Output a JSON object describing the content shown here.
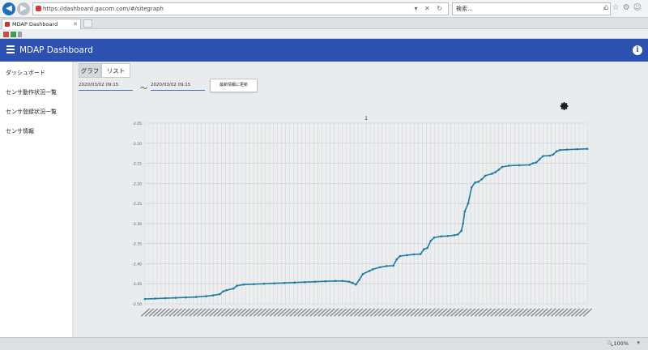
{
  "browser": {
    "url": "https://dashboard.gacom.com/#/sitegraph",
    "search_placeholder": "検索...",
    "tab_title": "MDAP Dashboard",
    "zoom": "100%"
  },
  "app": {
    "title": "MDAP Dashboard"
  },
  "sidebar": {
    "items": [
      {
        "label": "ダッシュボード"
      },
      {
        "label": "センサ動作状況一覧"
      },
      {
        "label": "センサ登録状況一覧"
      },
      {
        "label": "センサ情報"
      }
    ]
  },
  "main": {
    "tabs": [
      {
        "label": "グラフ",
        "active": true
      },
      {
        "label": "リスト",
        "active": false
      }
    ],
    "date_from": "2020/03/02 09:15",
    "date_to": "2020/03/02 09:15",
    "tilde": "〜",
    "update_button": "最新情報に更新"
  },
  "chart_data": {
    "type": "line",
    "title": "1",
    "ylim": [
      -2.5,
      -2.05
    ],
    "yticks": [
      -2.05,
      -2.1,
      -2.15,
      -2.2,
      -2.25,
      -2.3,
      -2.35,
      -2.4,
      -2.45,
      -2.5
    ],
    "grid": true,
    "series_color": "#1a7ea3",
    "points": [
      [
        0,
        -2.488
      ],
      [
        3,
        -2.487
      ],
      [
        6,
        -2.486
      ],
      [
        9,
        -2.485
      ],
      [
        12,
        -2.484
      ],
      [
        15,
        -2.483
      ],
      [
        18,
        -2.481
      ],
      [
        20,
        -2.479
      ],
      [
        22,
        -2.476
      ],
      [
        23,
        -2.469
      ],
      [
        24,
        -2.466
      ],
      [
        26,
        -2.462
      ],
      [
        27,
        -2.455
      ],
      [
        29,
        -2.452
      ],
      [
        32,
        -2.451
      ],
      [
        35,
        -2.45
      ],
      [
        38,
        -2.449
      ],
      [
        41,
        -2.448
      ],
      [
        44,
        -2.447
      ],
      [
        47,
        -2.446
      ],
      [
        50,
        -2.445
      ],
      [
        53,
        -2.444
      ],
      [
        56,
        -2.443
      ],
      [
        58,
        -2.443
      ],
      [
        60,
        -2.445
      ],
      [
        61,
        -2.448
      ],
      [
        62,
        -2.452
      ],
      [
        63,
        -2.44
      ],
      [
        64,
        -2.426
      ],
      [
        66,
        -2.418
      ],
      [
        67,
        -2.414
      ],
      [
        69,
        -2.409
      ],
      [
        71,
        -2.406
      ],
      [
        73,
        -2.405
      ],
      [
        74,
        -2.389
      ],
      [
        75,
        -2.381
      ],
      [
        77,
        -2.379
      ],
      [
        79,
        -2.377
      ],
      [
        81,
        -2.376
      ],
      [
        82,
        -2.364
      ],
      [
        83,
        -2.361
      ],
      [
        84,
        -2.343
      ],
      [
        85,
        -2.335
      ],
      [
        87,
        -2.332
      ],
      [
        89,
        -2.331
      ],
      [
        91,
        -2.329
      ],
      [
        92,
        -2.327
      ],
      [
        93,
        -2.318
      ],
      [
        93.5,
        -2.3
      ],
      [
        94,
        -2.27
      ],
      [
        95,
        -2.25
      ],
      [
        96,
        -2.21
      ],
      [
        97,
        -2.198
      ],
      [
        98,
        -2.196
      ],
      [
        99,
        -2.19
      ],
      [
        100,
        -2.181
      ],
      [
        102,
        -2.176
      ],
      [
        103,
        -2.172
      ],
      [
        104,
        -2.166
      ],
      [
        105,
        -2.159
      ],
      [
        107,
        -2.156
      ],
      [
        110,
        -2.155
      ],
      [
        113,
        -2.154
      ],
      [
        114,
        -2.15
      ],
      [
        115,
        -2.148
      ],
      [
        116,
        -2.14
      ],
      [
        117,
        -2.132
      ],
      [
        119,
        -2.131
      ],
      [
        120,
        -2.128
      ],
      [
        121,
        -2.12
      ],
      [
        122,
        -2.117
      ],
      [
        124,
        -2.116
      ],
      [
        127,
        -2.115
      ],
      [
        130,
        -2.114
      ]
    ]
  }
}
